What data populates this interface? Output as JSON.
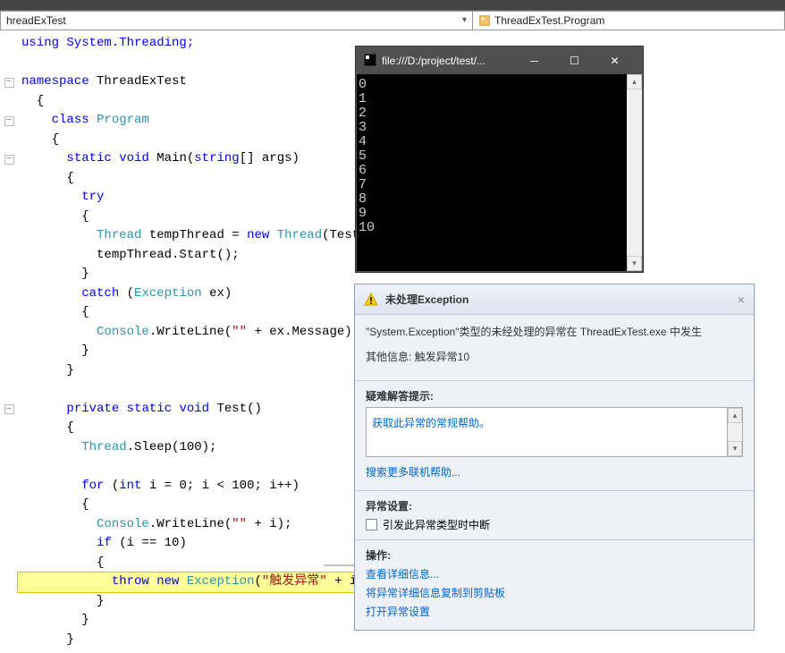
{
  "breadcrumb": {
    "left": "hreadExTest",
    "right": "ThreadExTest.Program"
  },
  "code": {
    "using": "using System.Threading;",
    "ns": "namespace",
    "nsName": "ThreadExTest",
    "class": "class",
    "className": "Program",
    "static": "static",
    "void": "void",
    "main": "Main",
    "string": "string",
    "args": "[] args)",
    "try": "try",
    "threadType": "Thread",
    "tempThread": " tempThread = ",
    "new": "new",
    "threadCtor": "Thread",
    "test": "(Test);",
    "startCall": "tempThread.Start();",
    "catch": "catch",
    "exception": "Exception",
    "ex": " ex)",
    "console": "Console",
    "writeLine": ".WriteLine(",
    "emptyStr": "\"\"",
    "plusExMsg": " + ex.Message);",
    "private": "private",
    "testMethod": "Test()",
    "sleep": "Thread",
    "sleepCall": ".Sleep(100);",
    "for": "for",
    "int": "int",
    "forCond": " i = 0; i < 100; i++)",
    "plusI": " + i);",
    "if": "if",
    "ifCond": " (i == 10)",
    "throw": "throw",
    "throwNew": "new",
    "throwType": "Exception",
    "throwStr": "\"触发异常\"",
    "throwTail": " + i);"
  },
  "console": {
    "title": "file:///D:/project/test/...",
    "output": "0\n1\n2\n3\n4\n5\n6\n7\n8\n9\n10"
  },
  "exception": {
    "title": "未处理Exception",
    "message": "\"System.Exception\"类型的未经处理的异常在 ThreadExTest.exe 中发生",
    "otherInfo": "其他信息: 触发异常10",
    "hintsTitle": "疑难解答提示:",
    "hint1": "获取此异常的常规帮助。",
    "searchMore": "搜索更多联机帮助...",
    "settingsTitle": "异常设置:",
    "checkboxLabel": "引发此异常类型时中断",
    "actionsTitle": "操作:",
    "action1": "查看详细信息...",
    "action2": "将异常详细信息复制到剪贴板",
    "action3": "打开异常设置"
  }
}
